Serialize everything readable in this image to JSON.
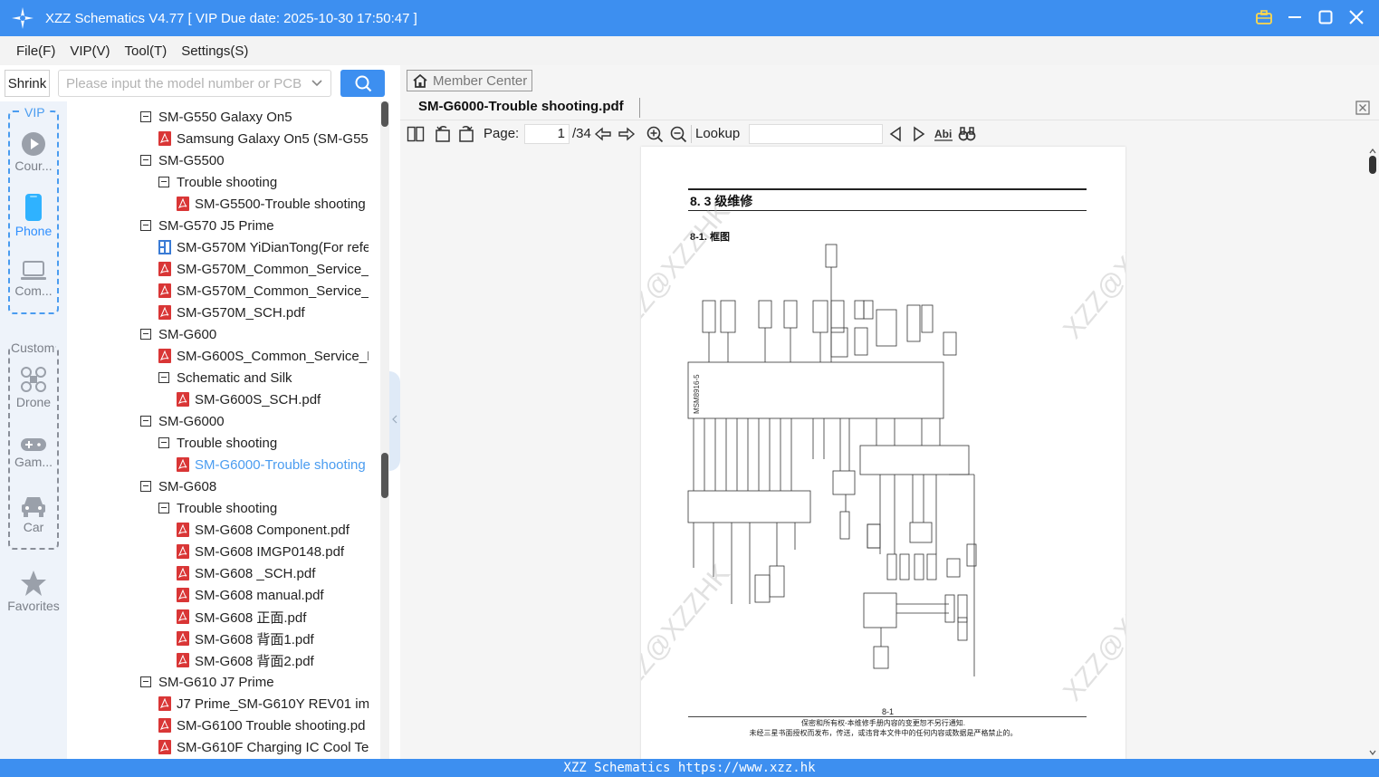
{
  "window": {
    "title": "XZZ Schematics V4.77 [ VIP Due date: 2025-10-30 17:50:47 ]"
  },
  "menu": [
    "File(F)",
    "VIP(V)",
    "Tool(T)",
    "Settings(S)"
  ],
  "search": {
    "shrink_label": "Shrink",
    "placeholder": "Please input the model number or PCB"
  },
  "categories": {
    "vip_label": "VIP",
    "custom_label": "Custom",
    "items": [
      {
        "label": "Cour...",
        "icon": "play-icon"
      },
      {
        "label": "Phone",
        "icon": "phone-icon"
      },
      {
        "label": "Com...",
        "icon": "laptop-icon"
      },
      {
        "label": "Drone",
        "icon": "drone-icon"
      },
      {
        "label": "Gam...",
        "icon": "gamepad-icon"
      },
      {
        "label": "Car",
        "icon": "car-icon"
      },
      {
        "label": "Favorites",
        "icon": "star-icon"
      }
    ]
  },
  "tree": [
    {
      "label": "SM-G550 Galaxy On5",
      "type": "folder",
      "level": 0
    },
    {
      "label": "Samsung Galaxy On5 (SM-G550",
      "type": "pdf",
      "level": 1
    },
    {
      "label": "SM-G5500",
      "type": "folder",
      "level": 0
    },
    {
      "label": "Trouble shooting",
      "type": "folder",
      "level": 1
    },
    {
      "label": "SM-G5500-Trouble shooting",
      "type": "pdf",
      "level": 2
    },
    {
      "label": "SM-G570 J5 Prime",
      "type": "folder",
      "level": 0
    },
    {
      "label": "SM-G570M YiDianTong(For refe",
      "type": "bitmap",
      "level": 1
    },
    {
      "label": "SM-G570M_Common_Service_F",
      "type": "pdf",
      "level": 1
    },
    {
      "label": "SM-G570M_Common_Service_F",
      "type": "pdf",
      "level": 1
    },
    {
      "label": "SM-G570M_SCH.pdf",
      "type": "pdf",
      "level": 1
    },
    {
      "label": "SM-G600",
      "type": "folder",
      "level": 0
    },
    {
      "label": "SM-G600S_Common_Service_Fu",
      "type": "pdf",
      "level": 1
    },
    {
      "label": "Schematic and Silk",
      "type": "folder",
      "level": 1
    },
    {
      "label": "SM-G600S_SCH.pdf",
      "type": "pdf",
      "level": 2
    },
    {
      "label": "SM-G6000",
      "type": "folder",
      "level": 0
    },
    {
      "label": "Trouble shooting",
      "type": "folder",
      "level": 1
    },
    {
      "label": "SM-G6000-Trouble shooting",
      "type": "pdf",
      "level": 2,
      "selected": true
    },
    {
      "label": "SM-G608",
      "type": "folder",
      "level": 0
    },
    {
      "label": "Trouble shooting",
      "type": "folder",
      "level": 1
    },
    {
      "label": "SM-G608 Component.pdf",
      "type": "pdf",
      "level": 2
    },
    {
      "label": "SM-G608 IMGP0148.pdf",
      "type": "pdf",
      "level": 2
    },
    {
      "label": "SM-G608 _SCH.pdf",
      "type": "pdf",
      "level": 2
    },
    {
      "label": "SM-G608 manual.pdf",
      "type": "pdf",
      "level": 2
    },
    {
      "label": "SM-G608 正面.pdf",
      "type": "pdf",
      "level": 2
    },
    {
      "label": "SM-G608 背面1.pdf",
      "type": "pdf",
      "level": 2
    },
    {
      "label": "SM-G608 背面2.pdf",
      "type": "pdf",
      "level": 2
    },
    {
      "label": "SM-G610 J7 Prime",
      "type": "folder",
      "level": 0
    },
    {
      "label": "J7 Prime_SM-G610Y REV01 imag",
      "type": "pdf",
      "level": 1
    },
    {
      "label": "SM-G6100 Trouble shooting.pd",
      "type": "pdf",
      "level": 1
    },
    {
      "label": "SM-G610F Charging IC Cool Tes",
      "type": "pdf",
      "level": 1
    }
  ],
  "viewer": {
    "member_center": "Member Center",
    "tab_title": "SM-G6000-Trouble shooting.pdf",
    "page_label": "Page:",
    "page_current": "1",
    "page_total": "/34",
    "lookup_label": "Lookup"
  },
  "pdf": {
    "heading": "8. 3 级维修",
    "subheading": "8-1. 框图",
    "page_number": "8-1",
    "footer_line1": "保密和所有权-本维修手册内容的变更恕不另行通知.",
    "footer_line2": "未经三星书面授权而发布，传送，或违背本文件中的任何内容或数据是严格禁止的。",
    "watermark": "XZZ@XZZHK",
    "chip_label": "MSM8916-5"
  },
  "status": {
    "text": "XZZ Schematics https://www.xzz.hk"
  },
  "colors": {
    "accent": "#3d8ff0",
    "selected_text": "#4a9cf0",
    "pdf_icon": "#d93636"
  }
}
